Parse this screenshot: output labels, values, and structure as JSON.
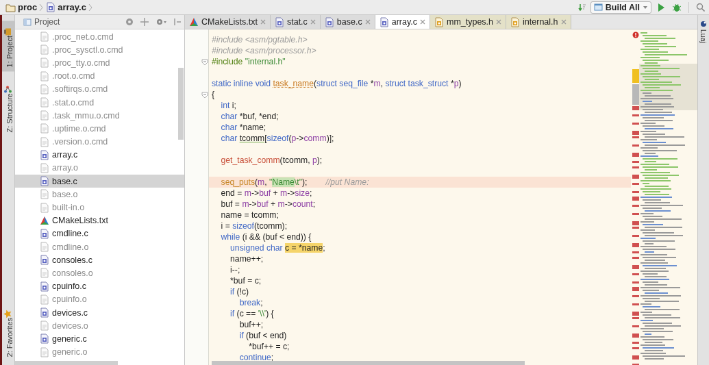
{
  "breadcrumb": [
    {
      "label": "proc",
      "kind": "folder"
    },
    {
      "label": "array.c",
      "kind": "c"
    }
  ],
  "toolbar": {
    "configuration": "Build All"
  },
  "left_strip": [
    {
      "label": "1: Project",
      "selected": true,
      "kind": "project"
    },
    {
      "label": "Z: Structure",
      "selected": false,
      "kind": "structure"
    },
    {
      "label": "2: Favorites",
      "selected": false,
      "kind": "favorites"
    }
  ],
  "project_panel": {
    "title": "Project",
    "items": [
      {
        "name": ".proc_net.o.cmd",
        "kind": "cmd",
        "selected": false
      },
      {
        "name": ".proc_sysctl.o.cmd",
        "kind": "cmd",
        "selected": false
      },
      {
        "name": ".proc_tty.o.cmd",
        "kind": "cmd",
        "selected": false
      },
      {
        "name": ".root.o.cmd",
        "kind": "cmd",
        "selected": false
      },
      {
        "name": ".softirqs.o.cmd",
        "kind": "cmd",
        "selected": false
      },
      {
        "name": ".stat.o.cmd",
        "kind": "cmd",
        "selected": false
      },
      {
        "name": ".task_mmu.o.cmd",
        "kind": "cmd",
        "selected": false
      },
      {
        "name": ".uptime.o.cmd",
        "kind": "cmd",
        "selected": false
      },
      {
        "name": ".version.o.cmd",
        "kind": "cmd",
        "selected": false
      },
      {
        "name": "array.c",
        "kind": "c",
        "selected": false
      },
      {
        "name": "array.o",
        "kind": "o",
        "selected": false
      },
      {
        "name": "base.c",
        "kind": "c",
        "selected": true
      },
      {
        "name": "base.o",
        "kind": "o",
        "selected": false
      },
      {
        "name": "built-in.o",
        "kind": "o",
        "selected": false
      },
      {
        "name": "CMakeLists.txt",
        "kind": "cmake",
        "selected": false
      },
      {
        "name": "cmdline.c",
        "kind": "c",
        "selected": false
      },
      {
        "name": "cmdline.o",
        "kind": "o",
        "selected": false
      },
      {
        "name": "consoles.c",
        "kind": "c",
        "selected": false
      },
      {
        "name": "consoles.o",
        "kind": "o",
        "selected": false
      },
      {
        "name": "cpuinfo.c",
        "kind": "c",
        "selected": false
      },
      {
        "name": "cpuinfo.o",
        "kind": "o",
        "selected": false
      },
      {
        "name": "devices.c",
        "kind": "c",
        "selected": false
      },
      {
        "name": "devices.o",
        "kind": "o",
        "selected": false
      },
      {
        "name": "generic.c",
        "kind": "c",
        "selected": false
      },
      {
        "name": "generic.o",
        "kind": "o",
        "selected": false
      }
    ]
  },
  "tabs": [
    {
      "label": "CMakeLists.txt",
      "kind": "cmake",
      "selected": false
    },
    {
      "label": "stat.c",
      "kind": "c",
      "selected": false
    },
    {
      "label": "base.c",
      "kind": "c",
      "selected": false
    },
    {
      "label": "array.c",
      "kind": "c",
      "selected": true
    },
    {
      "label": "mm_types.h",
      "kind": "h",
      "selected": false
    },
    {
      "label": "internal.h",
      "kind": "h",
      "selected": false
    }
  ],
  "editor": {
    "lines": [
      {
        "fold_marker": false,
        "highlighted": false,
        "tokens": [
          {
            "kind": "comment",
            "text": "#include <asm/pgtable.h>"
          }
        ]
      },
      {
        "fold_marker": false,
        "highlighted": false,
        "tokens": [
          {
            "kind": "comment",
            "text": "#include <asm/processor.h>"
          }
        ]
      },
      {
        "fold_marker": true,
        "highlighted": false,
        "tokens": [
          {
            "kind": "preproc",
            "text": "#include "
          },
          {
            "kind": "string",
            "text": "\"internal.h\""
          }
        ]
      },
      {
        "fold_marker": false,
        "highlighted": false
      },
      {
        "fold_marker": false,
        "highlighted": false,
        "tokens": [
          {
            "kind": "keyword",
            "text": "static inline void "
          },
          {
            "kind": "func_decl",
            "text": "task_name"
          },
          {
            "kind": "plain",
            "text": "("
          },
          {
            "kind": "keyword",
            "text": "struct seq_file "
          },
          {
            "kind": "plain",
            "text": "*"
          },
          {
            "kind": "field",
            "text": "m"
          },
          {
            "kind": "plain",
            "text": ", "
          },
          {
            "kind": "keyword",
            "text": "struct task_struct "
          },
          {
            "kind": "plain",
            "text": "*"
          },
          {
            "kind": "field",
            "text": "p"
          },
          {
            "kind": "plain",
            "text": ")"
          }
        ]
      },
      {
        "fold_marker": true,
        "highlighted": false,
        "tokens": [
          {
            "kind": "plain",
            "text": "{"
          }
        ]
      },
      {
        "fold_marker": false,
        "highlighted": false,
        "tokens": [
          {
            "kind": "keyword",
            "text": "    int "
          },
          {
            "kind": "plain",
            "text": "i;"
          }
        ]
      },
      {
        "fold_marker": false,
        "highlighted": false,
        "tokens": [
          {
            "kind": "keyword",
            "text": "    char "
          },
          {
            "kind": "plain",
            "text": "*buf, *end;"
          }
        ]
      },
      {
        "fold_marker": false,
        "highlighted": false,
        "tokens": [
          {
            "kind": "keyword",
            "text": "    char "
          },
          {
            "kind": "plain",
            "text": "*name;"
          }
        ]
      },
      {
        "fold_marker": false,
        "highlighted": false,
        "tokens": [
          {
            "kind": "keyword",
            "text": "    char "
          },
          {
            "kind": "warn",
            "text": "tcomm"
          },
          {
            "kind": "plain",
            "text": "["
          },
          {
            "kind": "keyword",
            "text": "sizeof"
          },
          {
            "kind": "plain",
            "text": "("
          },
          {
            "kind": "field",
            "text": "p"
          },
          {
            "kind": "plain",
            "text": "->"
          },
          {
            "kind": "field",
            "text": "comm"
          },
          {
            "kind": "plain",
            "text": ")];"
          }
        ]
      },
      {
        "fold_marker": false,
        "highlighted": false
      },
      {
        "fold_marker": false,
        "highlighted": false,
        "tokens": [
          {
            "kind": "func",
            "text": "    get_task_comm"
          },
          {
            "kind": "plain",
            "text": "(tcomm, "
          },
          {
            "kind": "field",
            "text": "p"
          },
          {
            "kind": "plain",
            "text": ");"
          }
        ]
      },
      {
        "fold_marker": false,
        "highlighted": false
      },
      {
        "fold_marker": false,
        "highlighted": true,
        "tokens": [
          {
            "kind": "macro",
            "text": "    seq_puts"
          },
          {
            "kind": "plain",
            "text": "("
          },
          {
            "kind": "field",
            "text": "m"
          },
          {
            "kind": "plain",
            "text": ", "
          },
          {
            "kind": "string",
            "text": "\""
          },
          {
            "kind": "string_match",
            "text": "Name"
          },
          {
            "kind": "string",
            "text": "\\t\""
          },
          {
            "kind": "plain",
            "text": ");        "
          },
          {
            "kind": "comment",
            "text": "//put Name:"
          }
        ]
      },
      {
        "fold_marker": false,
        "highlighted": false,
        "tokens": [
          {
            "kind": "plain",
            "text": "    end = "
          },
          {
            "kind": "field",
            "text": "m"
          },
          {
            "kind": "plain",
            "text": "->"
          },
          {
            "kind": "field",
            "text": "buf"
          },
          {
            "kind": "plain",
            "text": " + "
          },
          {
            "kind": "field",
            "text": "m"
          },
          {
            "kind": "plain",
            "text": "->"
          },
          {
            "kind": "field",
            "text": "size"
          },
          {
            "kind": "plain",
            "text": ";"
          }
        ]
      },
      {
        "fold_marker": false,
        "highlighted": false,
        "tokens": [
          {
            "kind": "plain",
            "text": "    buf = "
          },
          {
            "kind": "field",
            "text": "m"
          },
          {
            "kind": "plain",
            "text": "->"
          },
          {
            "kind": "field",
            "text": "buf"
          },
          {
            "kind": "plain",
            "text": " + "
          },
          {
            "kind": "field",
            "text": "m"
          },
          {
            "kind": "plain",
            "text": "->"
          },
          {
            "kind": "field",
            "text": "count"
          },
          {
            "kind": "plain",
            "text": ";"
          }
        ]
      },
      {
        "fold_marker": false,
        "highlighted": false,
        "tokens": [
          {
            "kind": "plain",
            "text": "    name = tcomm;"
          }
        ]
      },
      {
        "fold_marker": false,
        "highlighted": false,
        "tokens": [
          {
            "kind": "plain",
            "text": "    i = "
          },
          {
            "kind": "keyword",
            "text": "sizeof"
          },
          {
            "kind": "plain",
            "text": "(tcomm);"
          }
        ]
      },
      {
        "fold_marker": false,
        "highlighted": false,
        "tokens": [
          {
            "kind": "keyword",
            "text": "    while"
          },
          {
            "kind": "plain",
            "text": " (i && (buf < end)) {"
          }
        ]
      },
      {
        "fold_marker": false,
        "highlighted": false,
        "tokens": [
          {
            "kind": "keyword",
            "text": "        unsigned char "
          },
          {
            "kind": "match",
            "text": "c = *name"
          },
          {
            "kind": "plain",
            "text": ";"
          }
        ]
      },
      {
        "fold_marker": false,
        "highlighted": false,
        "tokens": [
          {
            "kind": "plain",
            "text": "        name++;"
          }
        ]
      },
      {
        "fold_marker": false,
        "highlighted": false,
        "tokens": [
          {
            "kind": "plain",
            "text": "        i--;"
          }
        ]
      },
      {
        "fold_marker": false,
        "highlighted": false,
        "tokens": [
          {
            "kind": "plain",
            "text": "        *buf = c;"
          }
        ]
      },
      {
        "fold_marker": false,
        "highlighted": false,
        "tokens": [
          {
            "kind": "keyword",
            "text": "        if"
          },
          {
            "kind": "plain",
            "text": " (!c)"
          }
        ]
      },
      {
        "fold_marker": false,
        "highlighted": false,
        "tokens": [
          {
            "kind": "keyword",
            "text": "            break"
          },
          {
            "kind": "plain",
            "text": ";"
          }
        ]
      },
      {
        "fold_marker": false,
        "highlighted": false,
        "tokens": [
          {
            "kind": "keyword",
            "text": "        if"
          },
          {
            "kind": "plain",
            "text": " (c == "
          },
          {
            "kind": "string",
            "text": "'\\\\'"
          },
          {
            "kind": "plain",
            "text": ") {"
          }
        ]
      },
      {
        "fold_marker": false,
        "highlighted": false,
        "tokens": [
          {
            "kind": "plain",
            "text": "            buf++;"
          }
        ]
      },
      {
        "fold_marker": false,
        "highlighted": false,
        "tokens": [
          {
            "kind": "keyword",
            "text": "            if"
          },
          {
            "kind": "plain",
            "text": " (buf < end)"
          }
        ]
      },
      {
        "fold_marker": false,
        "highlighted": false,
        "tokens": [
          {
            "kind": "plain",
            "text": "                *buf++ = c;"
          }
        ]
      },
      {
        "fold_marker": false,
        "highlighted": false,
        "tokens": [
          {
            "kind": "keyword",
            "text": "            continue"
          },
          {
            "kind": "plain",
            "text": ";"
          }
        ]
      }
    ]
  },
  "right_strip": [
    {
      "label": "Luaj"
    }
  ]
}
